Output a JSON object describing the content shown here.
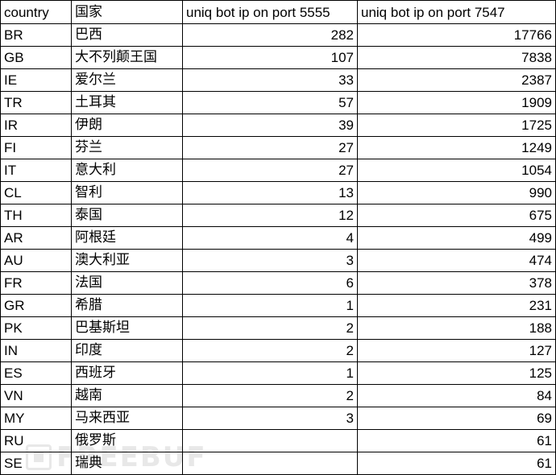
{
  "table": {
    "headers": {
      "code": "country",
      "name": "国家",
      "port5555": "uniq bot ip on port 5555",
      "port7547": "uniq bot ip on port 7547"
    },
    "rows": [
      {
        "code": "BR",
        "name": "巴西",
        "port5555": "282",
        "port7547": "17766"
      },
      {
        "code": "GB",
        "name": "大不列颠王国",
        "port5555": "107",
        "port7547": "7838"
      },
      {
        "code": "IE",
        "name": "爱尔兰",
        "port5555": "33",
        "port7547": "2387"
      },
      {
        "code": "TR",
        "name": "土耳其",
        "port5555": "57",
        "port7547": "1909"
      },
      {
        "code": "IR",
        "name": "伊朗",
        "port5555": "39",
        "port7547": "1725"
      },
      {
        "code": "FI",
        "name": "芬兰",
        "port5555": "27",
        "port7547": "1249"
      },
      {
        "code": "IT",
        "name": "意大利",
        "port5555": "27",
        "port7547": "1054"
      },
      {
        "code": "CL",
        "name": "智利",
        "port5555": "13",
        "port7547": "990"
      },
      {
        "code": "TH",
        "name": "泰国",
        "port5555": "12",
        "port7547": "675"
      },
      {
        "code": "AR",
        "name": "阿根廷",
        "port5555": "4",
        "port7547": "499"
      },
      {
        "code": "AU",
        "name": "澳大利亚",
        "port5555": "3",
        "port7547": "474"
      },
      {
        "code": "FR",
        "name": "法国",
        "port5555": "6",
        "port7547": "378"
      },
      {
        "code": "GR",
        "name": "希腊",
        "port5555": "1",
        "port7547": "231"
      },
      {
        "code": "PK",
        "name": "巴基斯坦",
        "port5555": "2",
        "port7547": "188"
      },
      {
        "code": "IN",
        "name": "印度",
        "port5555": "2",
        "port7547": "127"
      },
      {
        "code": "ES",
        "name": "西班牙",
        "port5555": "1",
        "port7547": "125"
      },
      {
        "code": "VN",
        "name": "越南",
        "port5555": "2",
        "port7547": "84"
      },
      {
        "code": "MY",
        "name": "马来西亚",
        "port5555": "3",
        "port7547": "69"
      },
      {
        "code": "RU",
        "name": "俄罗斯",
        "port5555": "",
        "port7547": "61"
      },
      {
        "code": "SE",
        "name": "瑞典",
        "port5555": "",
        "port7547": "61"
      }
    ]
  },
  "watermark": {
    "text": "FREEBUF",
    "icon": "freebuf-logo"
  }
}
